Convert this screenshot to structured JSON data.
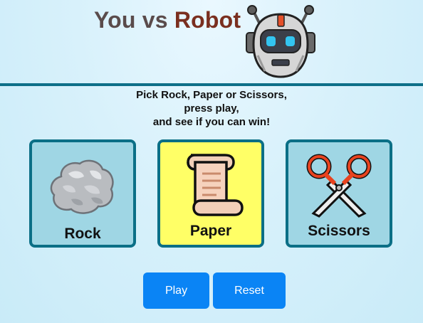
{
  "header": {
    "title_you": "You vs",
    "title_robot": "Robot",
    "robot_icon": "robot-face-icon"
  },
  "instructions": {
    "line1": "Pick Rock, Paper or Scissors,",
    "line2": "press play,",
    "line3": "and see if you can win!"
  },
  "choices": [
    {
      "label": "Rock",
      "icon": "rock-icon",
      "selected": false
    },
    {
      "label": "Paper",
      "icon": "scroll-icon",
      "selected": true
    },
    {
      "label": "Scissors",
      "icon": "scissors-icon",
      "selected": false
    }
  ],
  "buttons": {
    "play_label": "Play",
    "reset_label": "Reset"
  },
  "colors": {
    "card_default": "#9fd6e4",
    "card_selected": "#ffff66",
    "card_border": "#0b6f86",
    "button": "#0a84f5",
    "title_you": "#5a4b4b",
    "title_robot": "#7a2f1f",
    "divider": "#0e6f88"
  }
}
